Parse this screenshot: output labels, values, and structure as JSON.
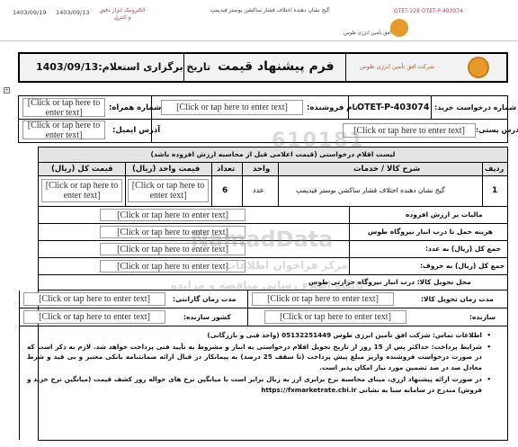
{
  "header_strip": {
    "date_1": "1403/09/19",
    "date_2": "1403/09/13",
    "category": "الکترونیک ابزار دقیق و کنترل",
    "item_title": "گیج نشان دهنده اختلاف فشار ساکشن بوستر فیدپمپ",
    "ref_numbers": "OTET-228 OTET-P-403074",
    "company_small": "افق تأمین انرژی طوس"
  },
  "title_bar": {
    "form_title": "فرم پیشنهاد قیمت",
    "meeting_date": "تاریخ برگزاری استعلام:1403/09/13",
    "logo_text": "شرکت افق تأمین انرژی طوس"
  },
  "placeholder": "[Click or tap here to enter text]",
  "info": {
    "request_no_label": "شماره درخواست خرید:",
    "request_no_value": "OTET-P-403074",
    "seller_label": "نام فروشنده:",
    "mobile_label": "شماره همراه:",
    "postal_label": "آدرس پستی:",
    "email_label": "آدرس ایمیل:"
  },
  "watermark": {
    "number": "610181",
    "brand": "NamadData",
    "line1": "مرکز فراخوان اطلاعات",
    "line2": "پایگاه اطلاع رسانی مناقصه و مزایده"
  },
  "table": {
    "caption": "لیست اقلام درخواستی (قیمت اعلامی قبل از محاسبه ارزش افزوده باشد)",
    "headers": {
      "row": "ردیف",
      "desc": "شرح کالا / خدمات",
      "unit": "واحد",
      "qty": "تعداد",
      "unit_price": "قیمت واحد (ریال)",
      "total_price": "قیمت کل (ریال)"
    },
    "rows": [
      {
        "row": "1",
        "desc": "گیج نشان دهنده اختلاف فشار ساکشن بوستر فیدپمپ",
        "unit": "عدد",
        "qty": "6"
      }
    ]
  },
  "summary": {
    "vat": "مالیات بر ارزش افزوده",
    "transport": "هزینه حمل تا درب انبار نیروگاه طوس",
    "sum_digits": "جمع کل (ریال) به عدد:",
    "sum_words": "جمع کل (ریال) به حروف:",
    "delivery_place": "محل تحویل کالا: درب انبار نیروگاه حرارتی طوس"
  },
  "delivery": {
    "delivery_time": "مدت زمان تحویل کالا:",
    "warranty": "مدت زمان گارانتی:",
    "manufacturer": "سازنده:",
    "country": "کشور سازنده:"
  },
  "notes": {
    "contact": "اطلاعات تماس: شرکت افق تأمین انرژی طوس 05132251449 (واحد فنی و بازرگانی)",
    "payment": "شرایط پرداخت: حداکثر پس از 15 روز از تاریخ تحویل اقلام درخواستی به انبار و مشروط به تأیید فنی پرداخت خواهد شد. لازم به ذکر است که در صورت درخواست فروشنده واریز مبلغ پیش پرداخت (تا سقف 25 درصد) به پیمانکار در قبال ارائه ضمانتنامه بانکی معتبر و بی قید و شرط معادل صد در صد تضمین مورد نیاز امکان پذیر است.",
    "currency": "در صورت ارائه پیشنهاد ارزی، مبنای محاسبه نرخ برابری ارز به ریال برابر است با میانگین نرخ های حواله روز کشف قیمت (میانگین نرخ خرید و فروش) مندرج در سامانه سنا به نشانی https://fxmarketrate.cbi.ir"
  }
}
